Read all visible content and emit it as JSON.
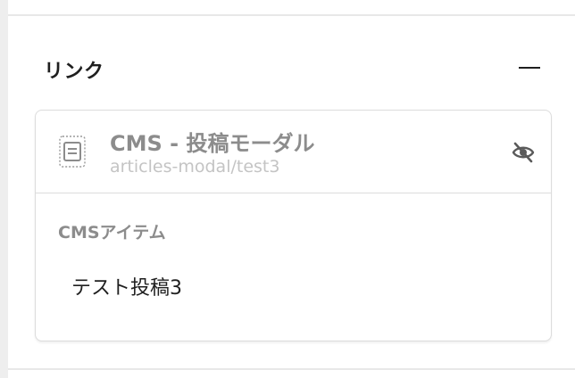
{
  "section": {
    "title": "リンク",
    "collapse_icon": "minus-icon"
  },
  "link_card": {
    "icon": "document-icon",
    "title": "CMS - 投稿モーダル",
    "path": "articles-modal/test3",
    "visibility_icon": "eye-off-icon",
    "field_label": "CMSアイテム",
    "field_value": "テスト投稿3"
  },
  "colors": {
    "text_primary": "#1f1f1f",
    "text_muted": "#8c8c8c",
    "text_faint": "#c4c4c4",
    "border": "#dcdcdc"
  }
}
